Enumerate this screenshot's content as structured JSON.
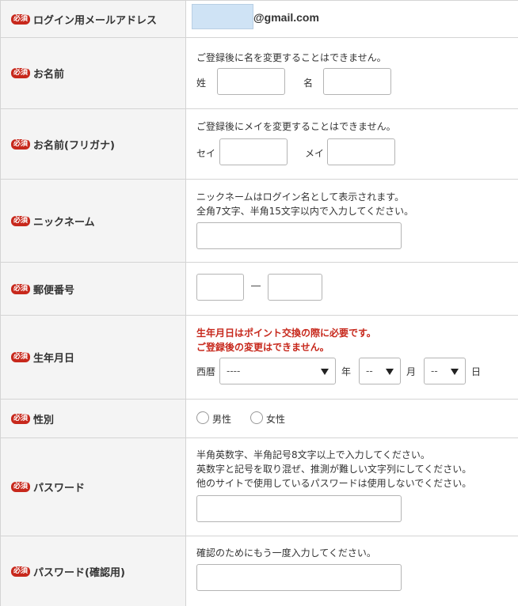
{
  "required_badge": "必須",
  "rows": {
    "email": {
      "label": "ログイン用メールアドレス",
      "domain": "@gmail.com"
    },
    "name": {
      "label": "お名前",
      "note": "ご登録後に名を変更することはできません。",
      "last_label": "姓",
      "first_label": "名"
    },
    "kana": {
      "label": "お名前(フリガナ)",
      "note": "ご登録後にメイを変更することはできません。",
      "last_label": "セイ",
      "first_label": "メイ"
    },
    "nickname": {
      "label": "ニックネーム",
      "note1": "ニックネームはログイン名として表示されます。",
      "note2": "全角7文字、半角15文字以内で入力してください。"
    },
    "postal": {
      "label": "郵便番号",
      "separator": "―"
    },
    "birthday": {
      "label": "生年月日",
      "note1": "生年月日はポイント交換の際に必要です。",
      "note2": "ご登録後の変更はできません。",
      "era_label": "西暦",
      "year_value": "----",
      "year_label": "年",
      "month_value": "--",
      "month_label": "月",
      "day_value": "--",
      "day_label": "日"
    },
    "gender": {
      "label": "性別",
      "male": "男性",
      "female": "女性"
    },
    "password": {
      "label": "パスワード",
      "note1": "半角英数字、半角記号8文字以上で入力してください。",
      "note2": "英数字と記号を取り混ぜ、推測が難しい文字列にしてください。",
      "note3": "他のサイトで使用しているパスワードは使用しないでください。"
    },
    "password_confirm": {
      "label": "パスワード(確認用)",
      "note": "確認のためにもう一度入力してください。"
    }
  },
  "colors": {
    "required_red": "#c7281c",
    "label_bg": "#f4f4f4",
    "border": "#d4d4d4",
    "email_highlight": "#cfe3f5"
  }
}
